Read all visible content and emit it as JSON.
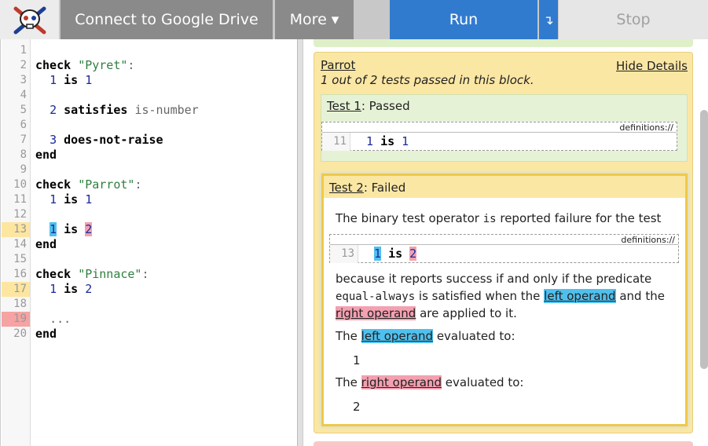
{
  "toolbar": {
    "connect_label": "Connect to Google Drive",
    "more_label": "More ▾",
    "run_label": "Run",
    "run_options_label": "↴",
    "stop_label": "Stop"
  },
  "editor": {
    "lines": [
      {
        "num": "1",
        "status": ""
      },
      {
        "num": "2",
        "status": ""
      },
      {
        "num": "3",
        "status": ""
      },
      {
        "num": "4",
        "status": ""
      },
      {
        "num": "5",
        "status": ""
      },
      {
        "num": "6",
        "status": ""
      },
      {
        "num": "7",
        "status": ""
      },
      {
        "num": "8",
        "status": ""
      },
      {
        "num": "9",
        "status": ""
      },
      {
        "num": "10",
        "status": ""
      },
      {
        "num": "11",
        "status": ""
      },
      {
        "num": "12",
        "status": ""
      },
      {
        "num": "13",
        "status": "warn"
      },
      {
        "num": "14",
        "status": ""
      },
      {
        "num": "15",
        "status": ""
      },
      {
        "num": "16",
        "status": ""
      },
      {
        "num": "17",
        "status": "warn"
      },
      {
        "num": "18",
        "status": ""
      },
      {
        "num": "19",
        "status": "err"
      },
      {
        "num": "20",
        "status": ""
      }
    ],
    "code": {
      "l2_kw": "check",
      "l2_str": "\"Pyret\"",
      "l2_colon": ":",
      "l3_a": "1",
      "l3_op": "is",
      "l3_b": "1",
      "l5_a": "2",
      "l5_op": "satisfies",
      "l5_fn": "is-number",
      "l7_a": "3",
      "l7_op": "does-not-raise",
      "l8_end": "end",
      "l10_kw": "check",
      "l10_str": "\"Parrot\"",
      "l10_colon": ":",
      "l11_a": "1",
      "l11_op": "is",
      "l11_b": "1",
      "l13_a": "1",
      "l13_op": "is",
      "l13_b": "2",
      "l14_end": "end",
      "l16_kw": "check",
      "l16_str": "\"Pinnace\"",
      "l16_colon": ":",
      "l17_a": "1",
      "l17_op": "is",
      "l17_b": "2",
      "l19_dots": "...",
      "l20_end": "end"
    }
  },
  "results": {
    "block_name": "Parrot",
    "block_summary": "1 out of 2 tests passed in this block.",
    "hide_details": "Hide Details",
    "test1": {
      "name": "Test 1",
      "status": ": Passed",
      "snippet_header": "definitions://",
      "line": "11",
      "code_a": "1",
      "code_op": "is",
      "code_b": "1"
    },
    "test2": {
      "name": "Test 2",
      "status": ": Failed",
      "p1_a": "The binary test operator ",
      "p1_op": "is",
      "p1_b": " reported failure for the test",
      "snippet_header": "definitions://",
      "line": "13",
      "code_a": "1",
      "code_op": "is",
      "code_b": "2",
      "p2_l1": "because it reports success if and only if the predicate",
      "p2_mono": "equal-always",
      "p2_l2b": " is satisfied when the ",
      "p2_lo": "left operand",
      "p2_l2c": " and the",
      "p2_ro": "right operand",
      "p2_l3b": " are applied to it.",
      "left_the": "The ",
      "left_lo": "left operand",
      "left_tail": " evaluated to:",
      "left_value": "1",
      "right_the": "The ",
      "right_ro": "right operand",
      "right_tail": " evaluated to:",
      "right_value": "2"
    }
  }
}
